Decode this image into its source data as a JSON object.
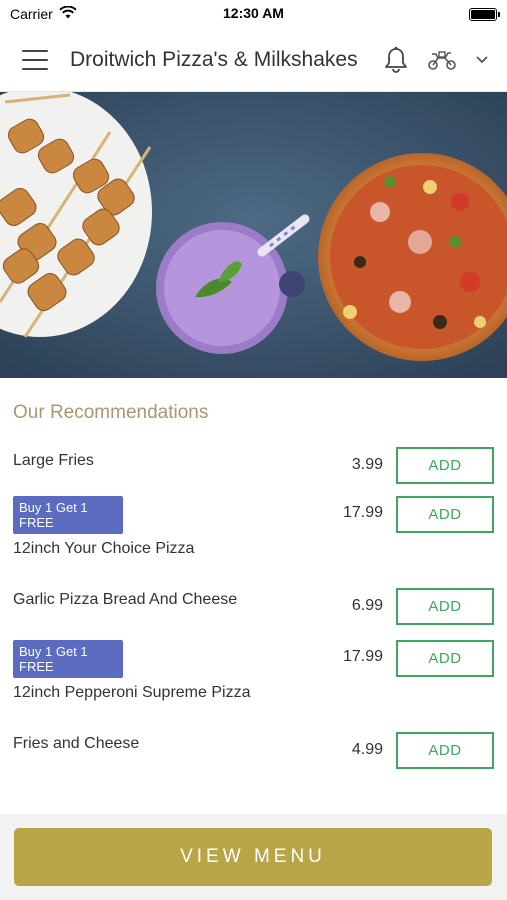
{
  "status_bar": {
    "carrier": "Carrier",
    "time": "12:30 AM",
    "icons": [
      "wifi-icon",
      "battery-icon"
    ]
  },
  "header": {
    "title": "Droitwich Pizza's & Milkshakes",
    "icons": [
      "menu-icon",
      "bell-icon",
      "scooter-icon",
      "chevron-down-icon"
    ]
  },
  "hero": {
    "image": "skewers, purple milkshake and pizza on slate background"
  },
  "recommendations": {
    "title": "Our Recommendations",
    "add_label": "ADD",
    "items": [
      {
        "name": "Large Fries",
        "price": "3.99",
        "badge": ""
      },
      {
        "name": "12inch Your Choice Pizza",
        "price": "17.99",
        "badge": "Buy 1 Get 1 FREE"
      },
      {
        "name": "Garlic Pizza Bread And Cheese",
        "price": "6.99",
        "badge": ""
      },
      {
        "name": "12inch Pepperoni Supreme Pizza",
        "price": "17.99",
        "badge": "Buy 1 Get 1 FREE"
      },
      {
        "name": "Fries and Cheese",
        "price": "4.99",
        "badge": ""
      }
    ]
  },
  "footer": {
    "view_menu_label": "VIEW MENU"
  },
  "colors": {
    "accent_gold": "#b8a548",
    "section_title": "#a89871",
    "add_green": "#3ea75f",
    "badge_blue": "#5b6bc0"
  }
}
